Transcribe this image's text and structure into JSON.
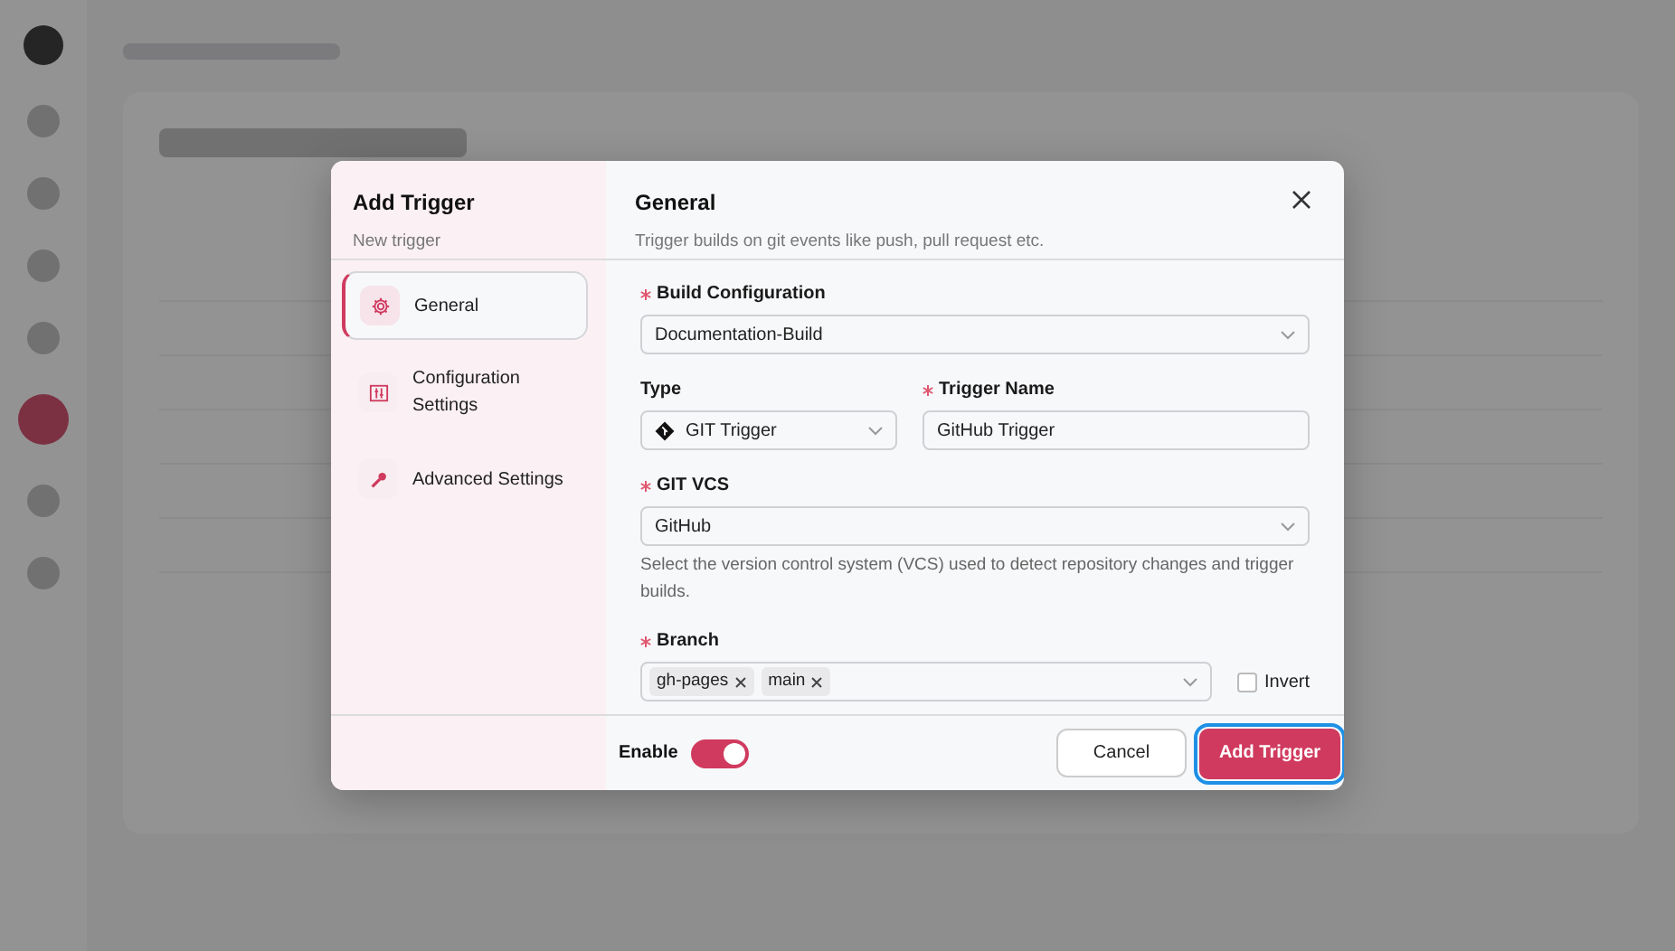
{
  "modal": {
    "title": "Add Trigger",
    "subtitle": "New trigger",
    "nav": [
      {
        "label": "General",
        "selected": true
      },
      {
        "label": "Configuration Settings",
        "selected": false
      },
      {
        "label": "Advanced Settings",
        "selected": false
      }
    ],
    "section": {
      "title": "General",
      "description": "Trigger builds on git events like push, pull request etc."
    },
    "build_configuration": {
      "label": "Build Configuration",
      "required": true,
      "value": "Documentation-Build"
    },
    "type": {
      "label": "Type",
      "required": false,
      "value": "GIT Trigger"
    },
    "trigger_name": {
      "label": "Trigger Name",
      "required": true,
      "value": "GitHub Trigger"
    },
    "git_vcs": {
      "label": "GIT VCS",
      "required": true,
      "value": "GitHub",
      "help": "Select the version control system (VCS) used to detect repository changes and trigger builds."
    },
    "branch": {
      "label": "Branch",
      "required": true,
      "tags": [
        "gh-pages",
        "main"
      ]
    },
    "invert": {
      "label": "Invert",
      "checked": false
    },
    "enable": {
      "label": "Enable",
      "on": true
    },
    "buttons": {
      "cancel": "Cancel",
      "submit": "Add Trigger"
    }
  }
}
